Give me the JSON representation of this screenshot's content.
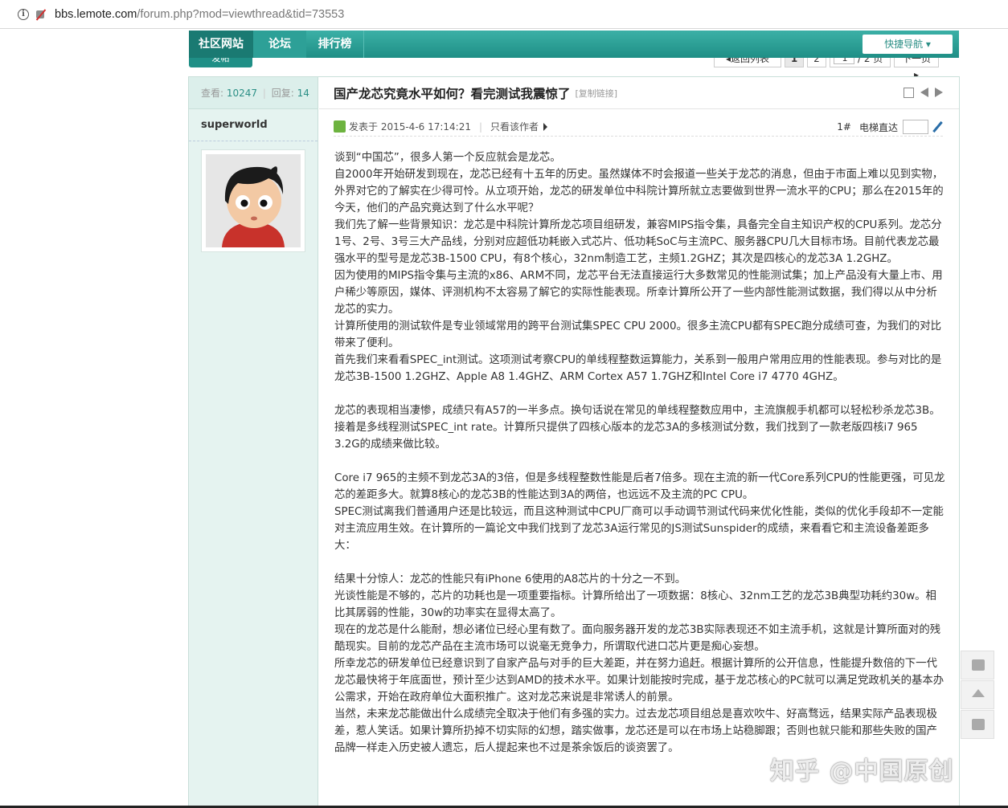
{
  "browser": {
    "url_host": "bbs.lemote.com",
    "url_path": "/forum.php?mod=viewthread&tid=73553"
  },
  "nav": {
    "home": "社区网站",
    "forum": "论坛",
    "rank": "排行榜",
    "quick_nav": "快捷导航 ▾",
    "new_post": "发帖"
  },
  "pager": {
    "back": "◂返回列表",
    "current": "1",
    "page2": "2",
    "jump_value": "1",
    "total": "/ 2 页",
    "next": "下一页 ▸"
  },
  "side": {
    "views_label": "查看:",
    "views": "10247",
    "replies_label": "回复:",
    "replies": "14",
    "author": "superworld"
  },
  "post": {
    "title": "国产龙芯究竟水平如何？看完测试我震惊了",
    "copy_link": "[复制链接]",
    "posted_at": "发表于 2015-4-6 17:14:21",
    "only_author": "只看该作者",
    "floor": "1#",
    "elevator": "电梯直达"
  },
  "content": [
    "谈到“中国芯”，很多人第一个反应就会是龙芯。",
    "自2000年开始研发到现在，龙芯已经有十五年的历史。虽然媒体不时会报道一些关于龙芯的消息，但由于市面上难以见到实物，外界对它的了解实在少得可怜。从立项开始，龙芯的研发单位中科院计算所就立志要做到世界一流水平的CPU；那么在2015年的今天，他们的产品究竟达到了什么水平呢？",
    "我们先了解一些背景知识：龙芯是中科院计算所龙芯项目组研发，兼容MIPS指令集，具备完全自主知识产权的CPU系列。龙芯分1号、2号、3号三大产品线，分别对应超低功耗嵌入式芯片、低功耗SoC与主流PC、服务器CPU几大目标市场。目前代表龙芯最强水平的型号是龙芯3B-1500 CPU，有8个核心，32nm制造工艺，主频1.2GHZ；其次是四核心的龙芯3A 1.2GHZ。",
    "因为使用的MIPS指令集与主流的x86、ARM不同，龙芯平台无法直接运行大多数常见的性能测试集；加上产品没有大量上市、用户稀少等原因，媒体、评测机构不太容易了解它的实际性能表现。所幸计算所公开了一些内部性能测试数据，我们得以从中分析龙芯的实力。",
    "计算所使用的测试软件是专业领域常用的跨平台测试集SPEC CPU 2000。很多主流CPU都有SPEC跑分成绩可查，为我们的对比带来了便利。",
    "首先我们来看看SPEC_int测试。这项测试考察CPU的单线程整数运算能力，关系到一般用户常用应用的性能表现。参与对比的是龙芯3B-1500 1.2GHZ、Apple A8 1.4GHZ、ARM Cortex A57 1.7GHZ和Intel Core i7 4770 4GHZ。",
    "",
    "龙芯的表现相当凄惨，成绩只有A57的一半多点。换句话说在常见的单线程整数应用中，主流旗舰手机都可以轻松秒杀龙芯3B。",
    "接着是多线程测试SPEC_int rate。计算所只提供了四核心版本的龙芯3A的多核测试分数，我们找到了一款老版四核i7 965 3.2G的成绩来做比较。",
    "",
    "Core i7 965的主频不到龙芯3A的3倍，但是多线程整数性能是后者7倍多。现在主流的新一代Core系列CPU的性能更强，可见龙芯的差距多大。就算8核心的龙芯3B的性能达到3A的两倍，也远远不及主流的PC CPU。",
    "SPEC测试离我们普通用户还是比较远，而且这种测试中CPU厂商可以手动调节测试代码来优化性能，类似的优化手段却不一定能对主流应用生效。在计算所的一篇论文中我们找到了龙芯3A运行常见的JS测试Sunspider的成绩，来看看它和主流设备差距多大：",
    "",
    "结果十分惊人：龙芯的性能只有iPhone 6使用的A8芯片的十分之一不到。",
    "光谈性能是不够的，芯片的功耗也是一项重要指标。计算所给出了一项数据：8核心、32nm工艺的龙芯3B典型功耗约30w。相比其孱弱的性能，30w的功率实在显得太高了。",
    "现在的龙芯是什么能耐，想必诸位已经心里有数了。面向服务器开发的龙芯3B实际表现还不如主流手机，这就是计算所面对的残酷现实。目前的龙芯产品在主流市场可以说毫无竞争力，所谓取代进口芯片更是痴心妄想。",
    "所幸龙芯的研发单位已经意识到了自家产品与对手的巨大差距，并在努力追赶。根据计算所的公开信息，性能提升数倍的下一代龙芯最快将于年底面世，预计至少达到AMD的技术水平。如果计划能按时完成，基于龙芯核心的PC就可以满足党政机关的基本办公需求，开始在政府单位大面积推广。这对龙芯来说是非常诱人的前景。",
    "当然，未来龙芯能做出什么成绩完全取决于他们有多强的实力。过去龙芯项目组总是喜欢吹牛、好高骛远，结果实际产品表现极差，惹人笑话。如果计算所扔掉不切实际的幻想，踏实做事，龙芯还是可以在市场上站稳脚跟；否则也就只能和那些失败的国产品牌一样走入历史被人遗忘，后人提起来也不过是茶余饭后的谈资罢了。"
  ],
  "watermark": "知乎 @中国原创"
}
